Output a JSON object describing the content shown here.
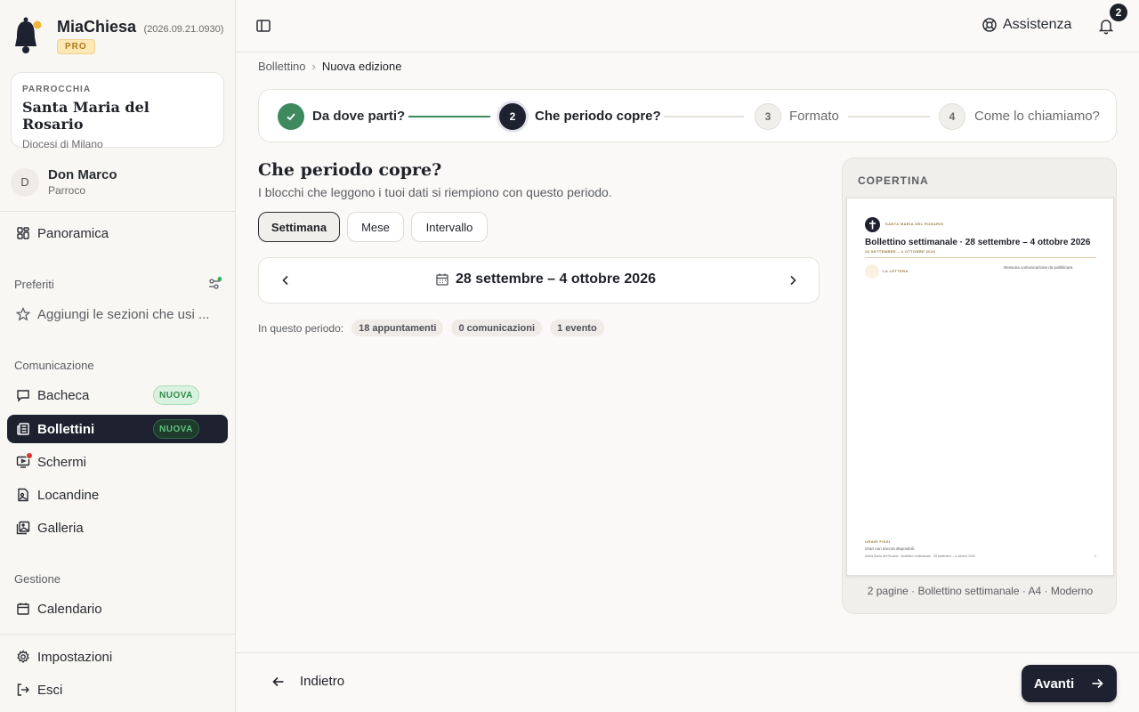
{
  "app": {
    "name": "MiaChiesa",
    "version": "(2026.09.21.0930)",
    "plan_badge": "PRO"
  },
  "parish": {
    "kicker": "PARROCCHIA",
    "name": "Santa Maria del Rosario",
    "diocese": "Diocesi di Milano"
  },
  "user": {
    "initial": "D",
    "name": "Don Marco",
    "role": "Parroco"
  },
  "nav": {
    "overview": "Panoramica",
    "favorites_section": "Preferiti",
    "favorites_hint": "Aggiungi le sezioni che usi ...",
    "communication_section": "Comunicazione",
    "bacheca": "Bacheca",
    "bollettini": "Bollettini",
    "new_badge": "NUOVA",
    "schermi": "Schermi",
    "locandine": "Locandine",
    "galleria": "Galleria",
    "management_section": "Gestione",
    "calendario": "Calendario",
    "impostazioni": "Impostazioni",
    "esci": "Esci"
  },
  "topbar": {
    "assist_label": "Assistenza",
    "notification_count": "2"
  },
  "breadcrumb": {
    "parent": "Bollettino",
    "current": "Nuova edizione"
  },
  "stepper": {
    "steps": [
      {
        "number": "1",
        "label": "Da dove parti?",
        "state": "done"
      },
      {
        "number": "2",
        "label": "Che periodo copre?",
        "state": "current"
      },
      {
        "number": "3",
        "label": "Formato",
        "state": "todo"
      },
      {
        "number": "4",
        "label": "Come lo chiamiamo?",
        "state": "todo"
      }
    ]
  },
  "period": {
    "title": "Che periodo copre?",
    "subtitle": "I blocchi che leggono i tuoi dati si riempiono con questo periodo.",
    "options": [
      "Settimana",
      "Mese",
      "Intervallo"
    ],
    "selected_option": "Settimana",
    "range_label": "28 settembre – 4 ottobre 2026",
    "in_period_label": "In questo periodo:",
    "chips": [
      "18 appuntamenti",
      "0 comunicazioni",
      "1 evento"
    ]
  },
  "preview": {
    "kicker": "COPERTINA",
    "page": {
      "parish": "SANTA MARIA DEL ROSARIO",
      "title": "Bollettino settimanale · 28 settembre – 4 ottobre 2026",
      "dates": "28 SETTEMBRE – 4 OTTOBRE 2026",
      "letter_kicker": "LA LETTERA",
      "no_communications": "Nessuna comunicazione da pubblicare.",
      "hours_kicker": "ORARI FISSI",
      "hours_text": "Orari non ancora disponibili.",
      "footer": "Santa Maria del Rosario · Bollettino settimanale · 28 settembre – 4 ottobre 2026",
      "page_number": "1"
    },
    "caption": "2 pagine · Bollettino settimanale · A4 · Moderno"
  },
  "footer": {
    "back_label": "Indietro",
    "next_label": "Avanti"
  },
  "colors": {
    "accent_dark": "#1e2230",
    "success": "#3e8a5e",
    "badge_new": "#2f8a4a",
    "alert": "#e0342e"
  }
}
